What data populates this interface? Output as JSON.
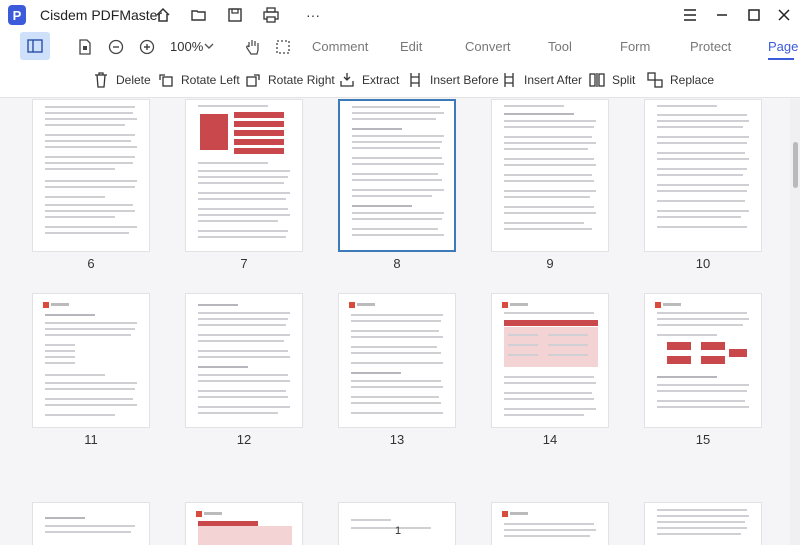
{
  "app": {
    "title": "Cisdem PDFMaster",
    "logo_letter": "P",
    "more": "···"
  },
  "menubar": {
    "zoom": "100%",
    "tabs": [
      {
        "label": "Comment"
      },
      {
        "label": "Edit"
      },
      {
        "label": "Convert"
      },
      {
        "label": "Tool"
      },
      {
        "label": "Form"
      },
      {
        "label": "Protect"
      },
      {
        "label": "Page",
        "active": true
      }
    ]
  },
  "toolbar": {
    "delete": "Delete",
    "rotate_left": "Rotate Left",
    "rotate_right": "Rotate Right",
    "extract": "Extract",
    "insert_before": "Insert Before",
    "insert_after": "Insert After",
    "split": "Split",
    "replace": "Replace"
  },
  "pages": {
    "row1": [
      "6",
      "7",
      "8",
      "9",
      "10"
    ],
    "row2": [
      "11",
      "12",
      "13",
      "14",
      "15"
    ],
    "selected": "8",
    "bottom_number": "1"
  },
  "colors": {
    "accent": "#3b5bdb",
    "selected_border": "#3d7ab8",
    "doc_red": "#c9484b"
  }
}
